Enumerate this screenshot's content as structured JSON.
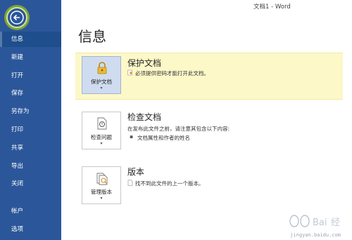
{
  "window": {
    "title": "文档1 - Word"
  },
  "sidebar": {
    "items": [
      {
        "label": "信息"
      },
      {
        "label": "新建"
      },
      {
        "label": "打开"
      },
      {
        "label": "保存"
      },
      {
        "label": "另存为"
      },
      {
        "label": "打印"
      },
      {
        "label": "共享"
      },
      {
        "label": "导出"
      },
      {
        "label": "关闭"
      },
      {
        "label": "帐户"
      },
      {
        "label": "选项"
      }
    ]
  },
  "main": {
    "title": "信息",
    "sections": [
      {
        "tile_label": "保护文档",
        "title": "保护文档",
        "desc": "必须提供密码才能打开此文档。"
      },
      {
        "tile_label": "检查问题",
        "title": "检查文档",
        "desc": "在发布此文件之前，请注意其包含以下内容:",
        "bullet": "文档属性和作者的姓名"
      },
      {
        "tile_label": "管理版本",
        "title": "版本",
        "desc": "找不到此文件的上一个版本。"
      }
    ]
  },
  "watermark": {
    "site": "jingyan.baidu.com"
  },
  "colors": {
    "sidebar": "#2b579a",
    "highlight": "#fdf8c8",
    "tile_active": "#cfdcef"
  }
}
